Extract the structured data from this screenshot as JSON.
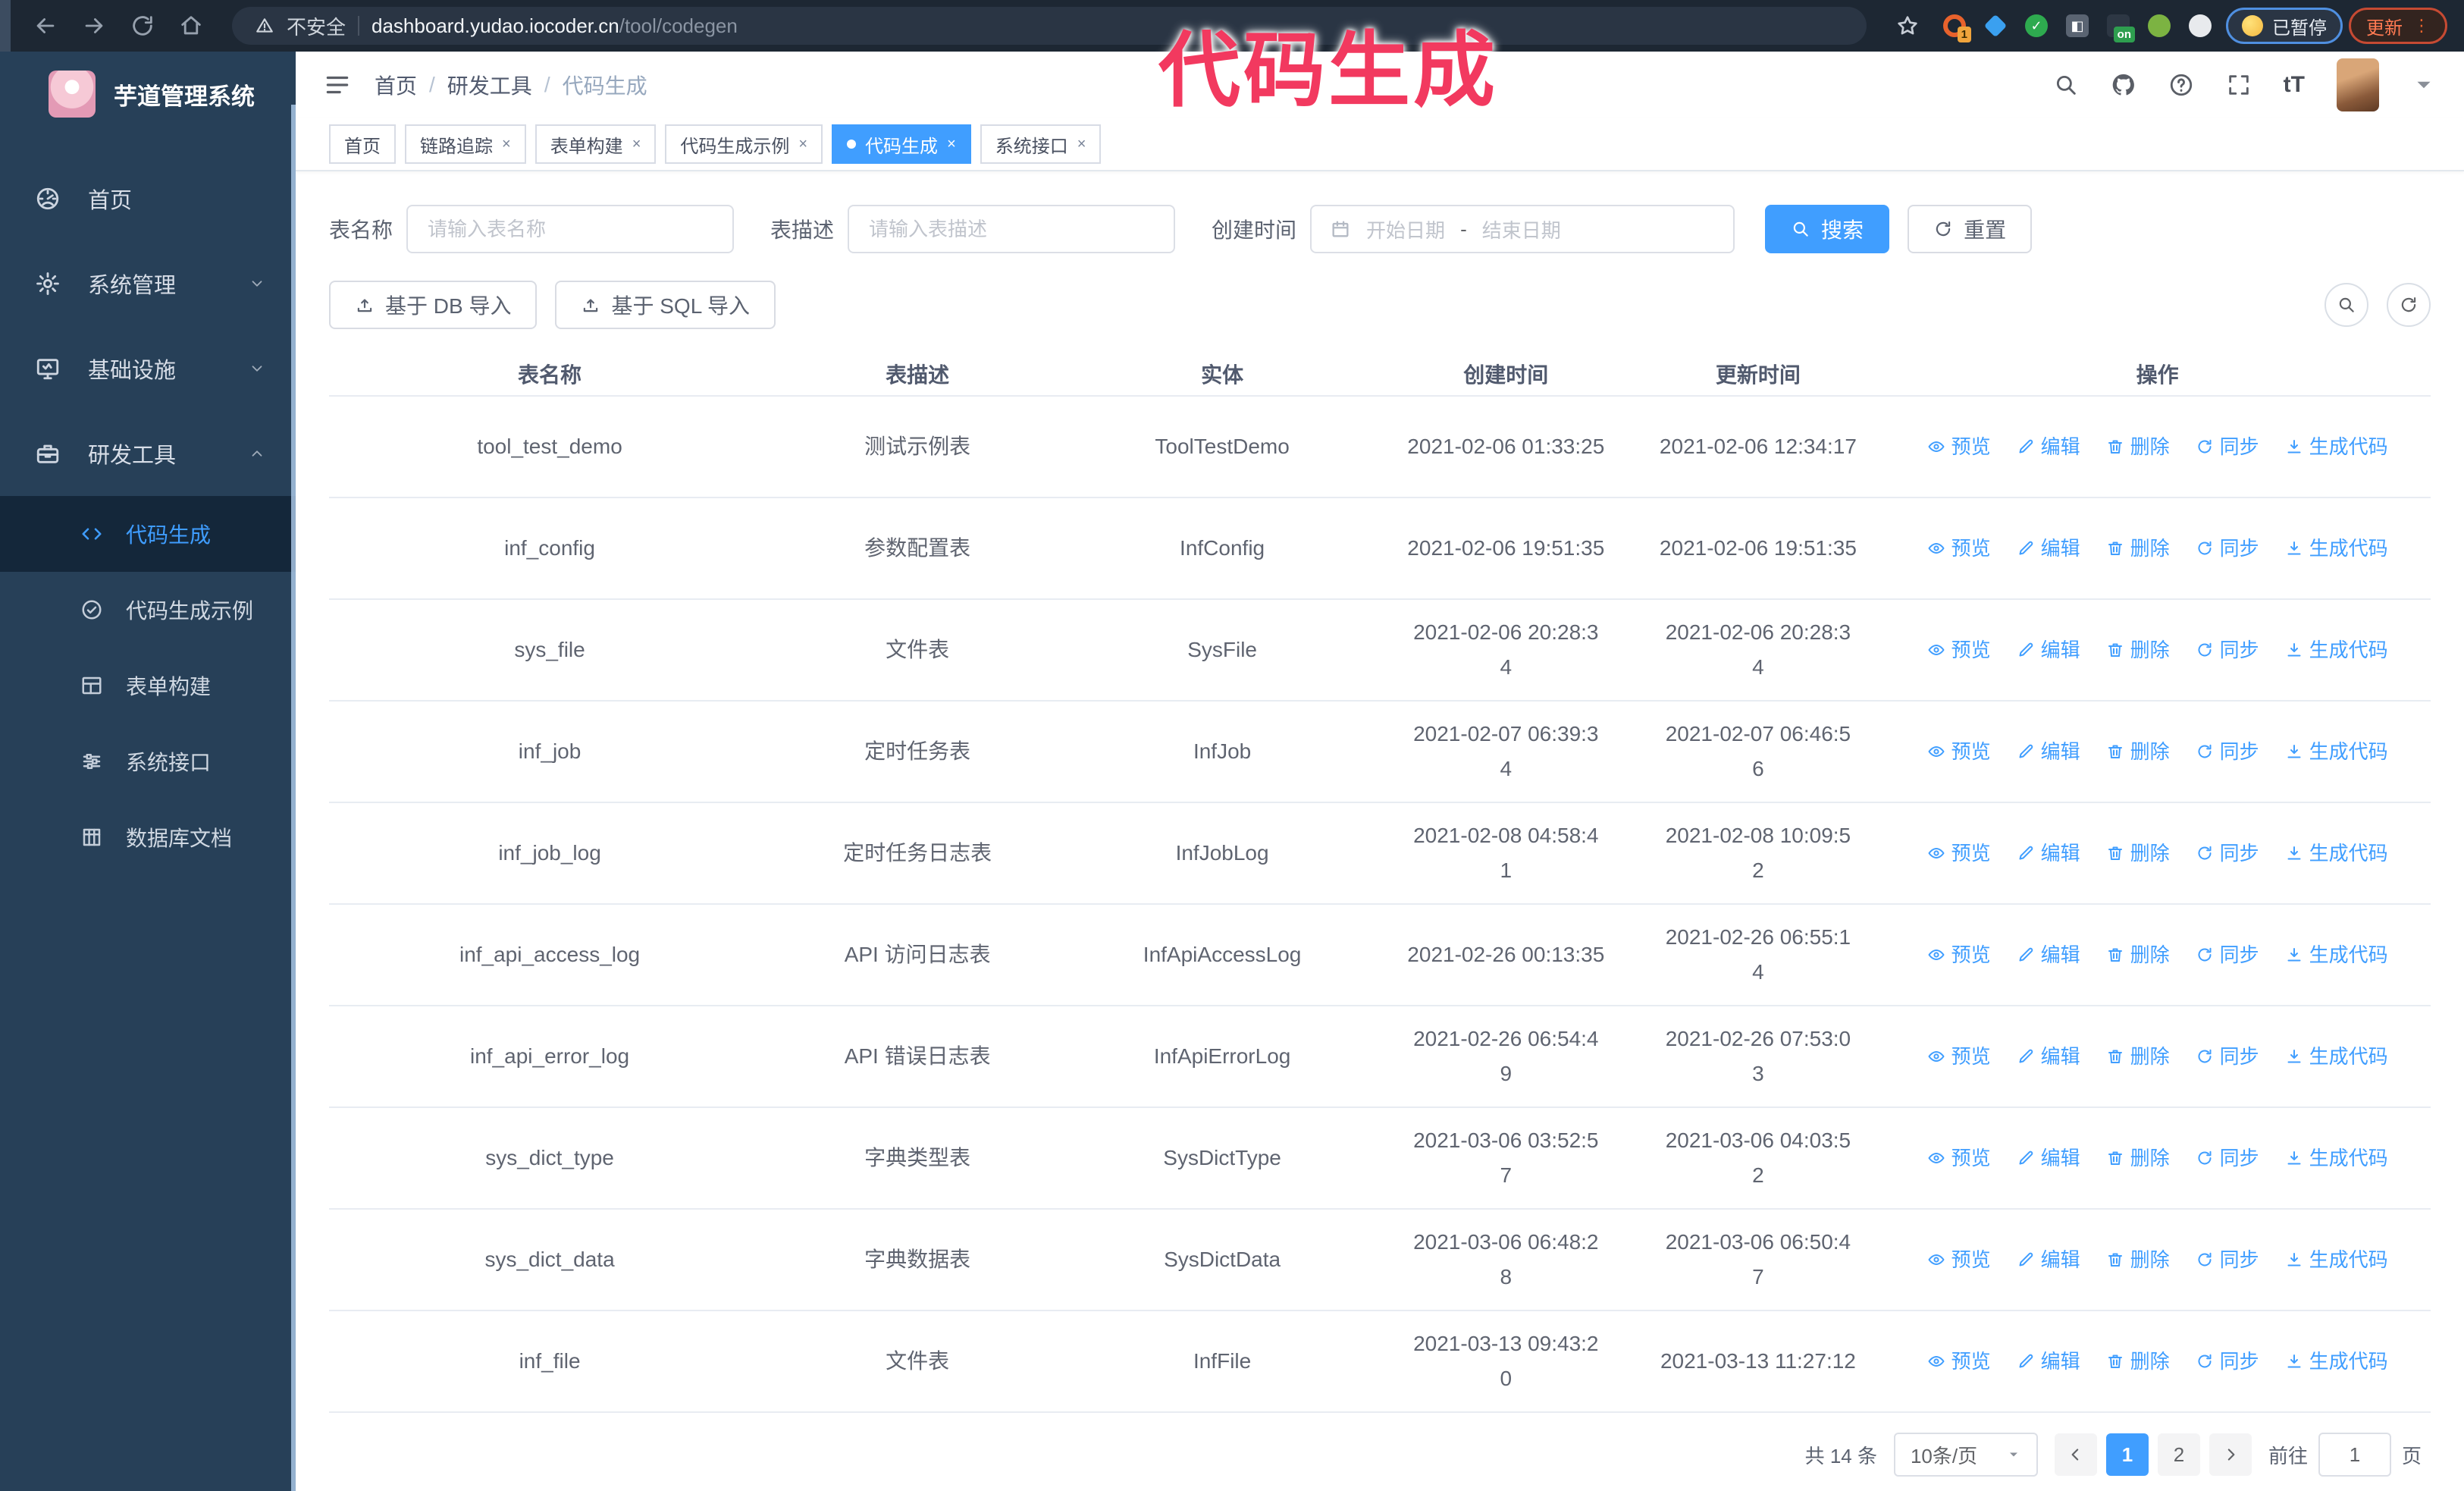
{
  "colors": {
    "accent": "#409eff",
    "sidebar_bg": "#274058",
    "sidebar_active_bg": "#14273a",
    "overlay_pink": "#f2395f",
    "browser_bar": "#1d2733"
  },
  "annotation": {
    "overlay_title": "代码生成"
  },
  "browser": {
    "insecure_label": "不安全",
    "url_host": "dashboard.yudao.iocoder.cn",
    "url_path": "/tool/codegen",
    "extensions": [
      {
        "name": "ext-orange-circle",
        "badge": "1",
        "color": "#e8622c",
        "shape": "ring"
      },
      {
        "name": "ext-blue-gem",
        "badge": "",
        "color": "#3aa0f0",
        "shape": "gem"
      },
      {
        "name": "ext-green-check",
        "badge": "",
        "color": "#2eaa4f",
        "shape": "circle",
        "glyph": "✓"
      },
      {
        "name": "ext-grid",
        "badge": "",
        "color": "#5a6472",
        "shape": "square",
        "glyph": "◧"
      },
      {
        "name": "ext-dark-on",
        "badge": "on",
        "color": "#2d3744",
        "shape": "square"
      },
      {
        "name": "ext-green-key",
        "badge": "",
        "color": "#7cb342",
        "shape": "circle"
      },
      {
        "name": "ext-puzzle",
        "badge": "",
        "color": "#e8eaed",
        "shape": "puzzle"
      }
    ],
    "paused_badge": "已暂停",
    "update_button": "更新"
  },
  "sidebar": {
    "app_title": "芋道管理系统",
    "items": [
      {
        "label": "首页",
        "icon": "dashboard-icon",
        "chevron": ""
      },
      {
        "label": "系统管理",
        "icon": "gear-icon",
        "chevron": "down"
      },
      {
        "label": "基础设施",
        "icon": "infra-icon",
        "chevron": "down"
      },
      {
        "label": "研发工具",
        "icon": "tools-icon",
        "chevron": "up"
      }
    ],
    "sub_items": [
      {
        "label": "代码生成",
        "icon": "code-icon",
        "active": true
      },
      {
        "label": "代码生成示例",
        "icon": "example-icon",
        "active": false
      },
      {
        "label": "表单构建",
        "icon": "form-icon",
        "active": false
      },
      {
        "label": "系统接口",
        "icon": "api-icon",
        "active": false
      },
      {
        "label": "数据库文档",
        "icon": "db-doc-icon",
        "active": false
      }
    ]
  },
  "navbar": {
    "breadcrumb": [
      "首页",
      "研发工具",
      "代码生成"
    ]
  },
  "tabs": [
    {
      "label": "首页",
      "closable": false,
      "active": false
    },
    {
      "label": "链路追踪",
      "closable": true,
      "active": false
    },
    {
      "label": "表单构建",
      "closable": true,
      "active": false
    },
    {
      "label": "代码生成示例",
      "closable": true,
      "active": false
    },
    {
      "label": "代码生成",
      "closable": true,
      "active": true
    },
    {
      "label": "系统接口",
      "closable": true,
      "active": false
    }
  ],
  "filters": {
    "table_name_label": "表名称",
    "table_name_placeholder": "请输入表名称",
    "table_desc_label": "表描述",
    "table_desc_placeholder": "请输入表描述",
    "create_time_label": "创建时间",
    "date_start_placeholder": "开始日期",
    "date_separator": "-",
    "date_end_placeholder": "结束日期",
    "search_button": "搜索",
    "reset_button": "重置"
  },
  "toolbar": {
    "import_db_button": "基于 DB 导入",
    "import_sql_button": "基于 SQL 导入"
  },
  "table": {
    "columns": [
      "表名称",
      "表描述",
      "实体",
      "创建时间",
      "更新时间",
      "操作"
    ],
    "actions": [
      {
        "label": "预览",
        "icon": "eye-icon"
      },
      {
        "label": "编辑",
        "icon": "edit-icon"
      },
      {
        "label": "删除",
        "icon": "delete-icon"
      },
      {
        "label": "同步",
        "icon": "sync-icon"
      },
      {
        "label": "生成代码",
        "icon": "download-icon"
      }
    ],
    "rows": [
      {
        "name": "tool_test_demo",
        "desc": "测试示例表",
        "entity": "ToolTestDemo",
        "create": "2021-02-06 01:33:25",
        "update": "2021-02-06 12:34:17"
      },
      {
        "name": "inf_config",
        "desc": "参数配置表",
        "entity": "InfConfig",
        "create": "2021-02-06 19:51:35",
        "update": "2021-02-06 19:51:35"
      },
      {
        "name": "sys_file",
        "desc": "文件表",
        "entity": "SysFile",
        "create": "2021-02-06 20:28:3\n4",
        "update": "2021-02-06 20:28:3\n4"
      },
      {
        "name": "inf_job",
        "desc": "定时任务表",
        "entity": "InfJob",
        "create": "2021-02-07 06:39:3\n4",
        "update": "2021-02-07 06:46:5\n6"
      },
      {
        "name": "inf_job_log",
        "desc": "定时任务日志表",
        "entity": "InfJobLog",
        "create": "2021-02-08 04:58:4\n1",
        "update": "2021-02-08 10:09:5\n2"
      },
      {
        "name": "inf_api_access_log",
        "desc": "API 访问日志表",
        "entity": "InfApiAccessLog",
        "create": "2021-02-26 00:13:35",
        "update": "2021-02-26 06:55:1\n4"
      },
      {
        "name": "inf_api_error_log",
        "desc": "API 错误日志表",
        "entity": "InfApiErrorLog",
        "create": "2021-02-26 06:54:4\n9",
        "update": "2021-02-26 07:53:0\n3"
      },
      {
        "name": "sys_dict_type",
        "desc": "字典类型表",
        "entity": "SysDictType",
        "create": "2021-03-06 03:52:5\n7",
        "update": "2021-03-06 04:03:5\n2"
      },
      {
        "name": "sys_dict_data",
        "desc": "字典数据表",
        "entity": "SysDictData",
        "create": "2021-03-06 06:48:2\n8",
        "update": "2021-03-06 06:50:4\n7"
      },
      {
        "name": "inf_file",
        "desc": "文件表",
        "entity": "InfFile",
        "create": "2021-03-13 09:43:2\n0",
        "update": "2021-03-13 11:27:12"
      }
    ]
  },
  "pagination": {
    "total": "共 14 条",
    "page_size": "10条/页",
    "pages": [
      "1",
      "2"
    ],
    "active_page": "1",
    "goto_label": "前往",
    "goto_value": "1",
    "goto_suffix": "页"
  }
}
